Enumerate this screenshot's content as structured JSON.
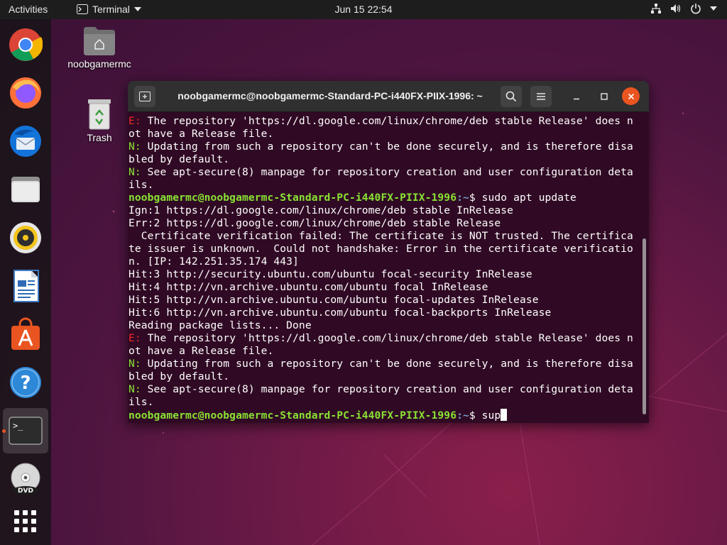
{
  "topbar": {
    "activities": "Activities",
    "app_name": "Terminal",
    "clock": "Jun 15  22:54",
    "tray_icons": [
      "network-icon",
      "volume-icon",
      "power-icon",
      "chevron-down-icon"
    ]
  },
  "dock": {
    "items": [
      "chrome",
      "firefox",
      "thunderbird",
      "files",
      "rhythmbox",
      "libreoffice-writer",
      "ubuntu-software",
      "help",
      "terminal",
      "dvd",
      "show-applications"
    ]
  },
  "desktop": {
    "home_label": "noobgamermc",
    "trash_label": "Trash"
  },
  "terminal": {
    "title": "noobgamermc@noobgamermc-Standard-PC-i440FX-PIIX-1996: ~",
    "lines": [
      {
        "t": "err",
        "p": "E:",
        "r": " The repository 'https://dl.google.com/linux/chrome/deb stable Release' does n"
      },
      {
        "t": "plain",
        "r": "ot have a Release file."
      },
      {
        "t": "note",
        "p": "N:",
        "r": " Updating from such a repository can't be done securely, and is therefore disa"
      },
      {
        "t": "plain",
        "r": "bled by default."
      },
      {
        "t": "note",
        "p": "N:",
        "r": " See apt-secure(8) manpage for repository creation and user configuration deta"
      },
      {
        "t": "plain",
        "r": "ils."
      },
      {
        "t": "prompt",
        "u": "noobgamermc@noobgamermc-Standard-PC-i440FX-PIIX-1996",
        "d": ":~",
        "r": "$ sudo apt update"
      },
      {
        "t": "plain",
        "r": "Ign:1 https://dl.google.com/linux/chrome/deb stable InRelease"
      },
      {
        "t": "plain",
        "r": "Err:2 https://dl.google.com/linux/chrome/deb stable Release"
      },
      {
        "t": "plain",
        "r": "  Certificate verification failed: The certificate is NOT trusted. The certifica"
      },
      {
        "t": "plain",
        "r": "te issuer is unknown.  Could not handshake: Error in the certificate verificatio"
      },
      {
        "t": "plain",
        "r": "n. [IP: 142.251.35.174 443]"
      },
      {
        "t": "plain",
        "r": "Hit:3 http://security.ubuntu.com/ubuntu focal-security InRelease"
      },
      {
        "t": "plain",
        "r": "Hit:4 http://vn.archive.ubuntu.com/ubuntu focal InRelease"
      },
      {
        "t": "plain",
        "r": "Hit:5 http://vn.archive.ubuntu.com/ubuntu focal-updates InRelease"
      },
      {
        "t": "plain",
        "r": "Hit:6 http://vn.archive.ubuntu.com/ubuntu focal-backports InRelease"
      },
      {
        "t": "plain",
        "r": "Reading package lists... Done"
      },
      {
        "t": "err",
        "p": "E:",
        "r": " The repository 'https://dl.google.com/linux/chrome/deb stable Release' does n"
      },
      {
        "t": "plain",
        "r": "ot have a Release file."
      },
      {
        "t": "note",
        "p": "N:",
        "r": " Updating from such a repository can't be done securely, and is therefore disa"
      },
      {
        "t": "plain",
        "r": "bled by default."
      },
      {
        "t": "note",
        "p": "N:",
        "r": " See apt-secure(8) manpage for repository creation and user configuration deta"
      },
      {
        "t": "plain",
        "r": "ils."
      },
      {
        "t": "prompt-input",
        "u": "noobgamermc@noobgamermc-Standard-PC-i440FX-PIIX-1996",
        "d": ":~",
        "r": "$ sup"
      }
    ]
  },
  "colors": {
    "accent": "#e95420",
    "terminal_bg": "#300a24",
    "prompt_user": "#8ae234",
    "prompt_path": "#729fcf",
    "error_prefix": "#ef2929",
    "note_prefix": "#8ae234"
  }
}
